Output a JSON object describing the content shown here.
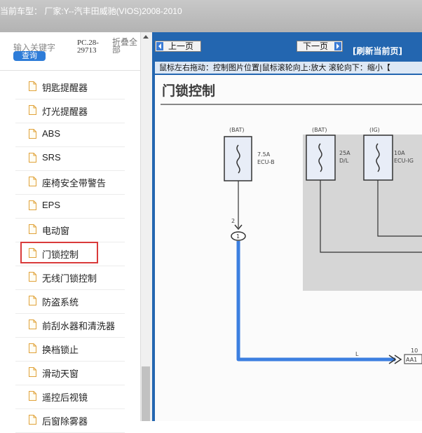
{
  "header": {
    "title": "当前车型：  厂家:Y--汽丰田威驰(VIOS)2008-2010"
  },
  "sidebar": {
    "search_hint": "输入关键字",
    "query_label": "查询",
    "pc_code": "PC.28-29713",
    "fold_all": "折叠全部",
    "items": [
      {
        "label": "钥匙提醒器"
      },
      {
        "label": "灯光提醒器"
      },
      {
        "label": "ABS"
      },
      {
        "label": "SRS"
      },
      {
        "label": "座椅安全带警告"
      },
      {
        "label": "EPS"
      },
      {
        "label": "电动窗"
      },
      {
        "label": "门锁控制"
      },
      {
        "label": "无线门锁控制"
      },
      {
        "label": "防盗系统"
      },
      {
        "label": "前刮水器和清洗器"
      },
      {
        "label": "换档锁止"
      },
      {
        "label": "滑动天窗"
      },
      {
        "label": "遥控后视镜"
      },
      {
        "label": "后窗除雾器"
      }
    ],
    "highlighted_index": 7
  },
  "toolbar": {
    "prev_label": "上一页",
    "next_label": "下一页",
    "refresh_label": "[刷新当前页]",
    "hint": "鼠标左右拖动：控制图片位置|鼠标滚轮向上:放大  滚轮向下：缩小【"
  },
  "diagram": {
    "title": "门锁控制",
    "fuses": [
      {
        "source": "(BAT)",
        "rating": "7.5A",
        "name": "ECU-B"
      },
      {
        "source": "(BAT)",
        "rating": "25A",
        "name": "D/L"
      },
      {
        "source": "(IG)",
        "rating": "10A",
        "name": "ECU-IG"
      }
    ],
    "pin_label": "2",
    "connector_label": "1",
    "wire_color_label": "L",
    "terminal_pin": "10",
    "terminal_label": "AA1"
  },
  "colors": {
    "header_bg": "#b8b8b8",
    "panel_blue": "#2366b0",
    "wire_blue": "#3c7fe0",
    "highlight_red": "#d93a3a",
    "button_blue": "#2e7cd8"
  }
}
